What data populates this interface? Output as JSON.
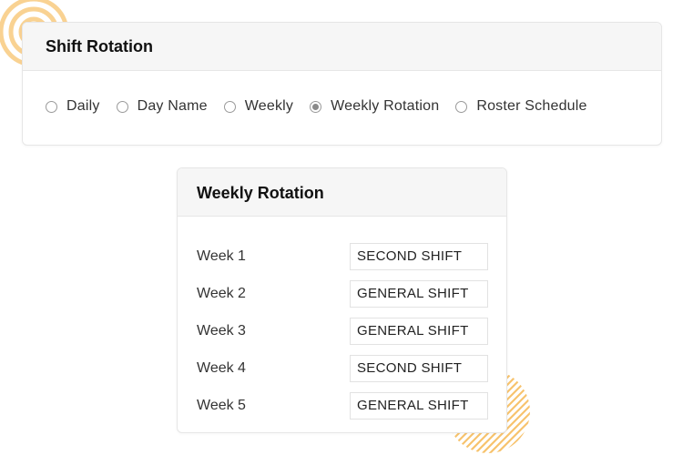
{
  "shift_rotation": {
    "title": "Shift Rotation",
    "options": [
      {
        "label": "Daily",
        "checked": false
      },
      {
        "label": "Day Name",
        "checked": false
      },
      {
        "label": "Weekly",
        "checked": false
      },
      {
        "label": "Weekly Rotation",
        "checked": true
      },
      {
        "label": "Roster Schedule",
        "checked": false
      }
    ]
  },
  "weekly_rotation": {
    "title": "Weekly Rotation",
    "weeks": [
      {
        "label": "Week 1",
        "shift": "SECOND SHIFT"
      },
      {
        "label": "Week 2",
        "shift": "GENERAL SHIFT"
      },
      {
        "label": "Week 3",
        "shift": "GENERAL SHIFT"
      },
      {
        "label": "Week 4",
        "shift": "SECOND SHIFT"
      },
      {
        "label": "Week 5",
        "shift": "GENERAL SHIFT"
      }
    ]
  },
  "colors": {
    "accent_orange": "#f7c36d",
    "header_bg": "#f6f6f6",
    "border": "#e6e6e6"
  }
}
